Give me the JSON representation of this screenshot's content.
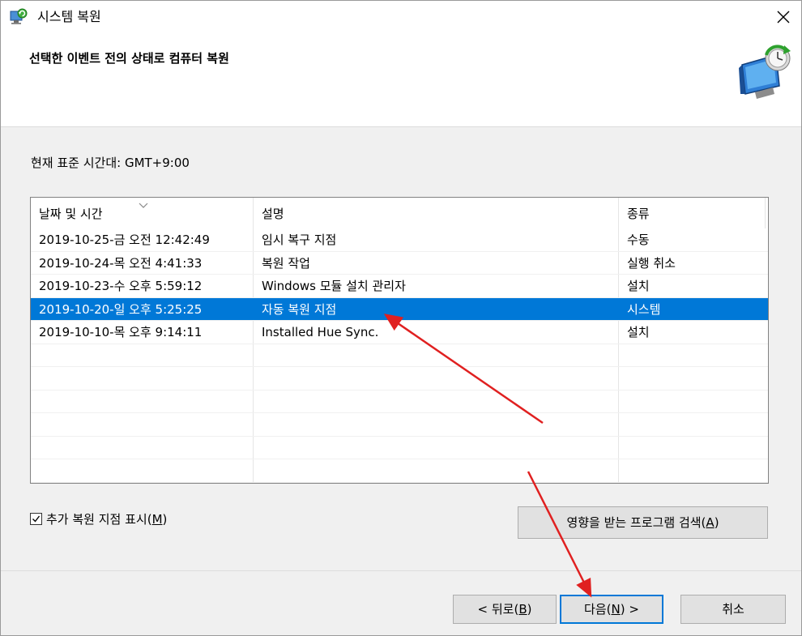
{
  "window": {
    "title": "시스템 복원",
    "heading": "선택한 이벤트 전의 상태로 컴퓨터 복원"
  },
  "timezone_label": "현재 표준 시간대: GMT+9:00",
  "list": {
    "columns": [
      "날짜 및 시간",
      "설명",
      "종류"
    ],
    "rows": [
      {
        "date": "2019-10-25-금 오전 12:42:49",
        "desc": "임시 복구 지점",
        "type": "수동",
        "selected": false
      },
      {
        "date": "2019-10-24-목 오전 4:41:33",
        "desc": "복원 작업",
        "type": "실행 취소",
        "selected": false
      },
      {
        "date": "2019-10-23-수 오후 5:59:12",
        "desc": "Windows 모듈 설치 관리자",
        "type": "설치",
        "selected": false
      },
      {
        "date": "2019-10-20-일 오후 5:25:25",
        "desc": "자동 복원 지점",
        "type": "시스템",
        "selected": true
      },
      {
        "date": "2019-10-10-목 오후 9:14:11",
        "desc": "Installed Hue Sync.",
        "type": "설치",
        "selected": false
      }
    ],
    "selection_color": "#0078d7"
  },
  "checkbox": {
    "label_pre": "추가 복원 지점 표시(",
    "mnemonic": "M",
    "label_post": ")",
    "checked": true
  },
  "buttons": {
    "scan": {
      "pre": "영향을 받는 프로그램 검색(",
      "mn": "A",
      "post": ")"
    },
    "back": {
      "pre": "< 뒤로(",
      "mn": "B",
      "post": ")"
    },
    "next": {
      "pre": "다음(",
      "mn": "N",
      "post": ") >"
    },
    "cancel": {
      "label": "취소"
    }
  },
  "annotation_color": "#e02020"
}
